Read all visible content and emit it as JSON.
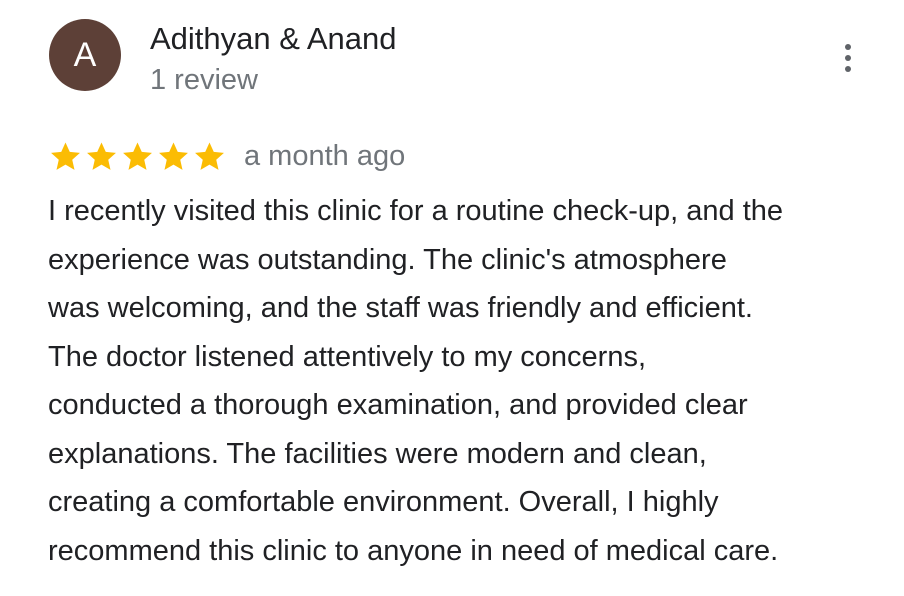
{
  "review": {
    "author": {
      "avatar_initial": "A",
      "avatar_color": "#5d4037",
      "name": "Adithyan & Anand",
      "meta": "1 review"
    },
    "menu_icon": "more-vert-icon",
    "rating": 5,
    "rating_max": 5,
    "star_icon": "star-icon",
    "star_color": "#fbbc04",
    "date": "a month ago",
    "text": "I recently visited this clinic for a routine check-up, and the\nexperience was outstanding. The clinic's atmosphere\nwas welcoming, and the staff was friendly and efficient.\nThe doctor listened attentively to my concerns,\nconducted a thorough examination, and provided clear\nexplanations. The facilities were modern and clean,\ncreating a comfortable environment. Overall, I highly\nrecommend this clinic to anyone in need of medical care."
  }
}
